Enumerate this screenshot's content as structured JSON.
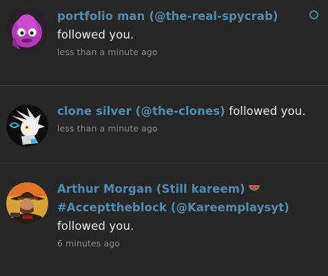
{
  "notifications": [
    {
      "avatar_icon": "purple-creature-avatar",
      "display_name": "portfolio man",
      "handle": "(@the-real-spycrab)",
      "action": "followed you.",
      "time": "less than a minute ago",
      "unread": true
    },
    {
      "avatar_icon": "silver-hedgehog-avatar",
      "display_name": "clone silver",
      "handle": "(@the-clones)",
      "action": "followed you.",
      "time": "less than a minute ago",
      "unread": false
    },
    {
      "avatar_icon": "cowboy-avatar",
      "display_name": "Arthur Morgan (Still kareem)",
      "display_name_emoji": "watermelon-emoji",
      "display_name_2": "#Accepttheblock",
      "handle": "(@Kareemplaysyt)",
      "action": "followed you.",
      "time": "6 minutes ago",
      "unread": false
    }
  ],
  "colors": {
    "background": "#262626",
    "name_link": "#4f8cb3",
    "text": "#ededed",
    "muted": "#8a8a8a",
    "divider": "#3c3c3c"
  }
}
